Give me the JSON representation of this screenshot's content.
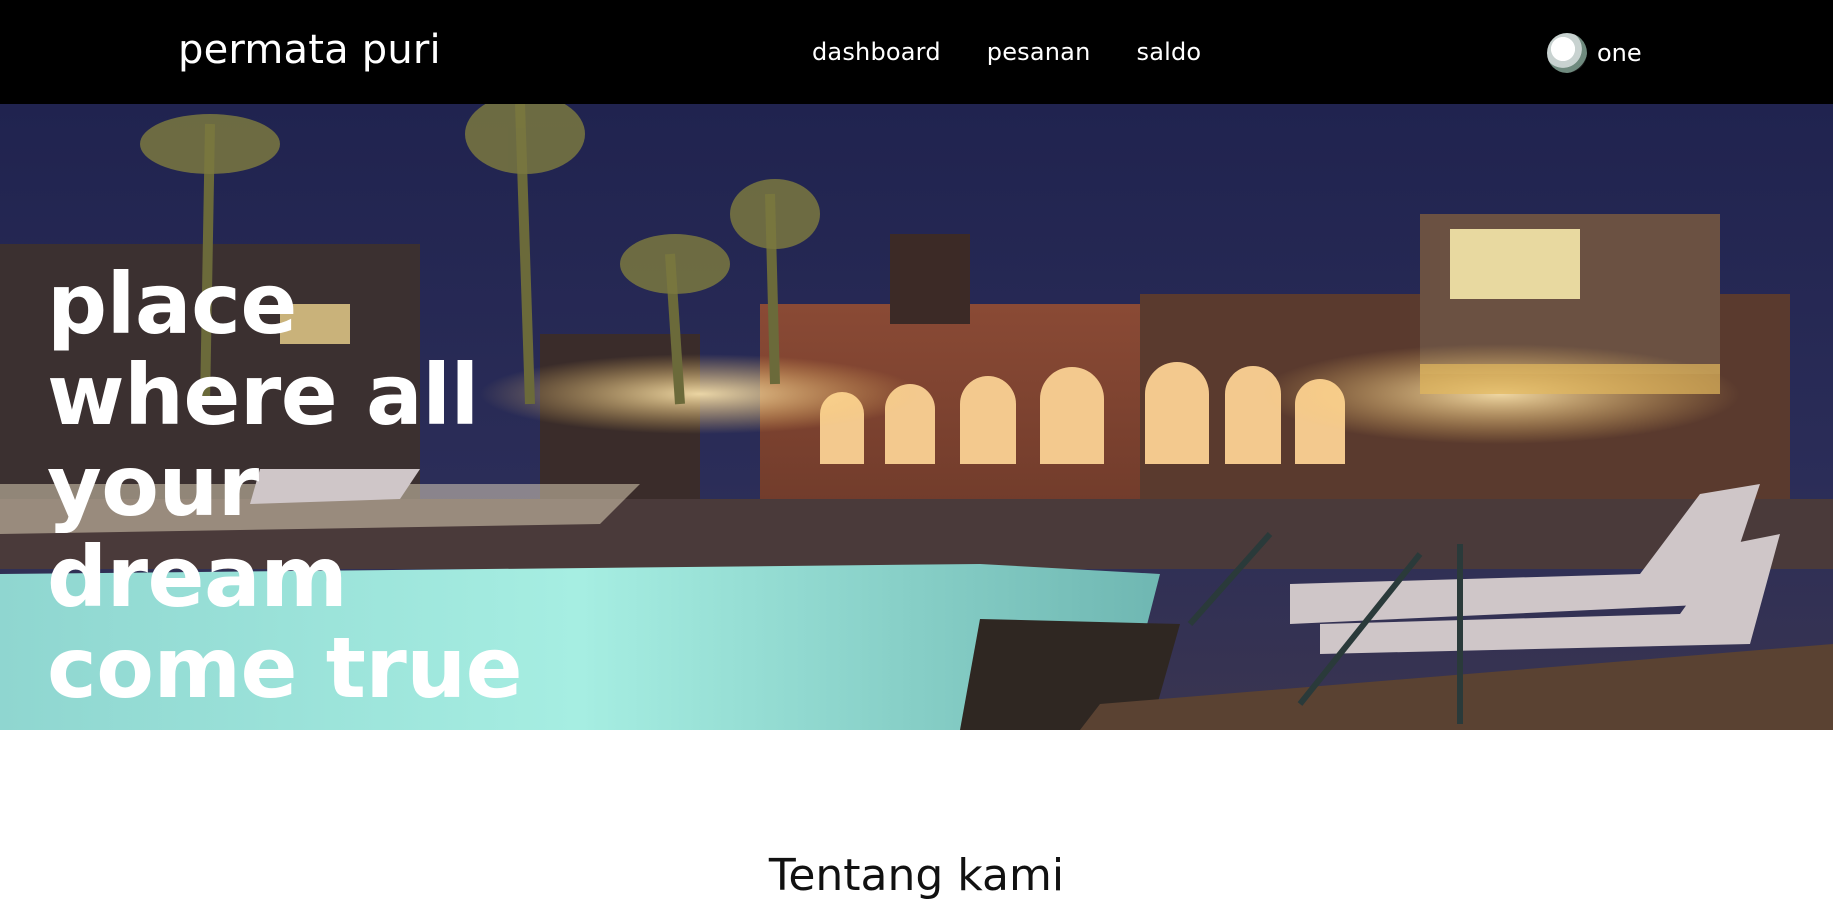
{
  "navbar": {
    "brand": "permata puri",
    "links": [
      "dashboard",
      "pesanan",
      "saldo"
    ],
    "user_name": "one",
    "avatar_icon": "user-avatar-icon"
  },
  "hero": {
    "title": "place where all your dream come true",
    "image": "resort-pool-night-photo"
  },
  "about": {
    "heading": "Tentang kami"
  },
  "colors": {
    "navbar_bg": "#000000",
    "text_light": "#ffffff",
    "text_dark": "#111111"
  }
}
